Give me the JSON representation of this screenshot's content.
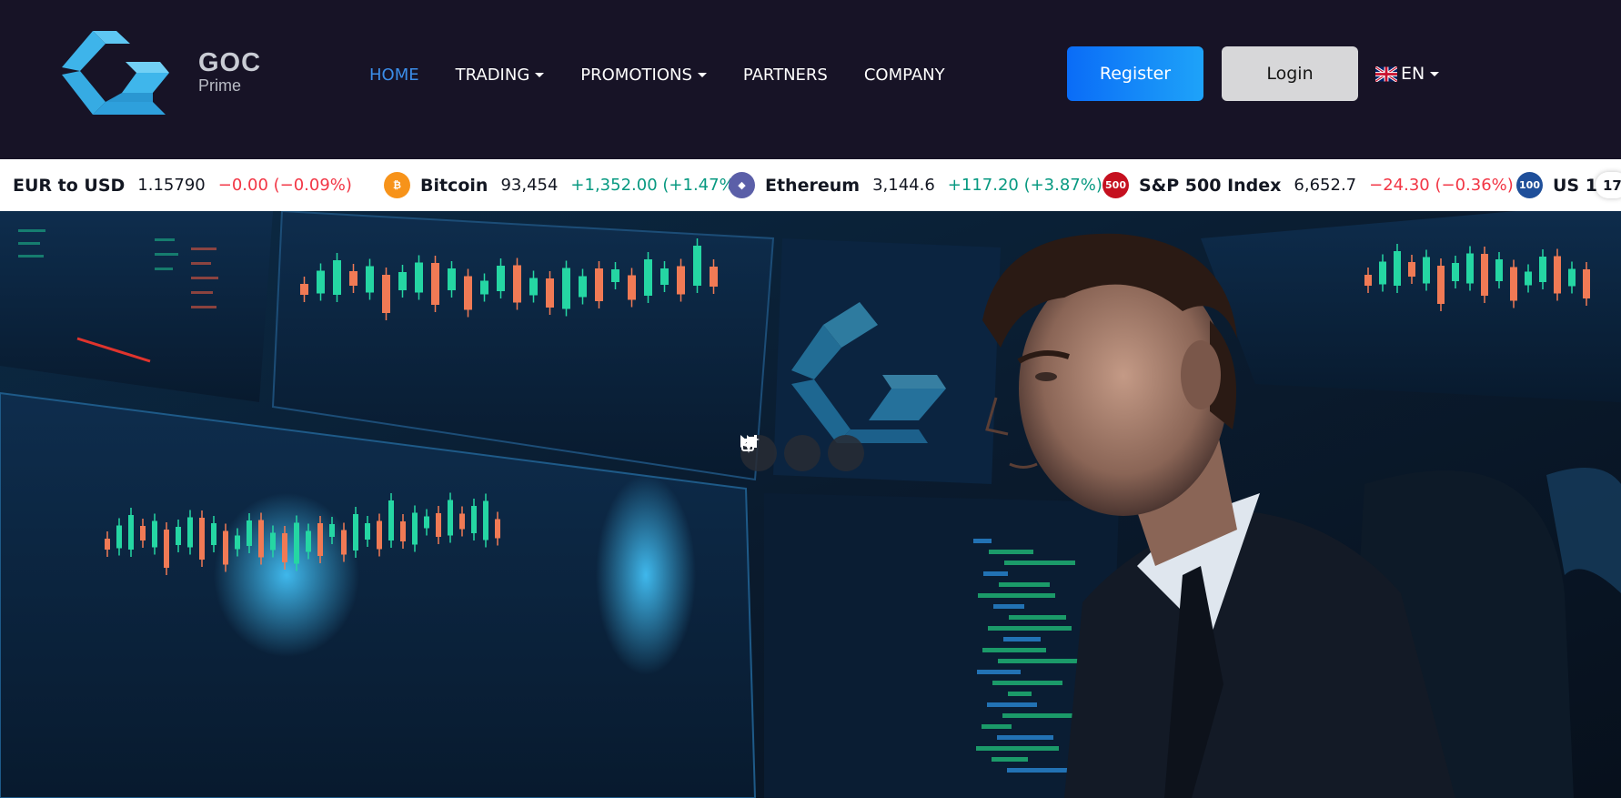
{
  "brand": {
    "name": "GOC",
    "sub": "Prime",
    "logo_icon": "goc-prime-logo-icon"
  },
  "nav": {
    "items": [
      {
        "label": "HOME",
        "active": true,
        "dropdown": false
      },
      {
        "label": "TRADING",
        "active": false,
        "dropdown": true
      },
      {
        "label": "PROMOTIONS",
        "active": false,
        "dropdown": true
      },
      {
        "label": "PARTNERS",
        "active": false,
        "dropdown": false
      },
      {
        "label": "COMPANY",
        "active": false,
        "dropdown": false
      }
    ]
  },
  "auth": {
    "register_label": "Register",
    "login_label": "Login"
  },
  "language": {
    "label": "EN",
    "flag_icon": "uk-flag-icon"
  },
  "ticker": {
    "items": [
      {
        "name": "EUR to USD",
        "price": "1.15790",
        "change": "−0.00 (−0.09%)",
        "direction": "down",
        "icon": ""
      },
      {
        "name": "Bitcoin",
        "price": "93,454",
        "change": "+1,352.00 (+1.47%",
        "direction": "up",
        "icon": "bitcoin-icon",
        "icon_text": "₿",
        "icon_color": "#f7931a"
      },
      {
        "name": "Ethereum",
        "price": "3,144.6",
        "change": "+117.20 (+3.87%)",
        "direction": "up",
        "icon": "ethereum-icon",
        "icon_text": "◆",
        "icon_color": "#5b5fa8"
      },
      {
        "name": "S&P 500 Index",
        "price": "6,652.7",
        "change": "−24.30 (−0.36%)",
        "direction": "down",
        "icon": "sp500-icon",
        "icon_text": "500",
        "icon_color": "#c5101f"
      },
      {
        "name": "US 1(",
        "price": "",
        "change": "",
        "direction": "",
        "icon": "us100-icon",
        "icon_text": "100",
        "icon_color": "#1f4f9a"
      }
    ],
    "badge_text": "17"
  },
  "hero": {
    "image_icon": "trader-desk-monitors-image",
    "controls": [
      "picture-in-picture-icon",
      "sparkle-icon",
      "skip-forward-icon"
    ]
  },
  "colors": {
    "header_bg": "#171326",
    "nav_active": "#3b8de8",
    "register_gradient_start": "#0a6cf7",
    "register_gradient_end": "#1ea3f9",
    "login_bg": "#d7d7d9",
    "ticker_up": "#089981",
    "ticker_down": "#f23645"
  }
}
